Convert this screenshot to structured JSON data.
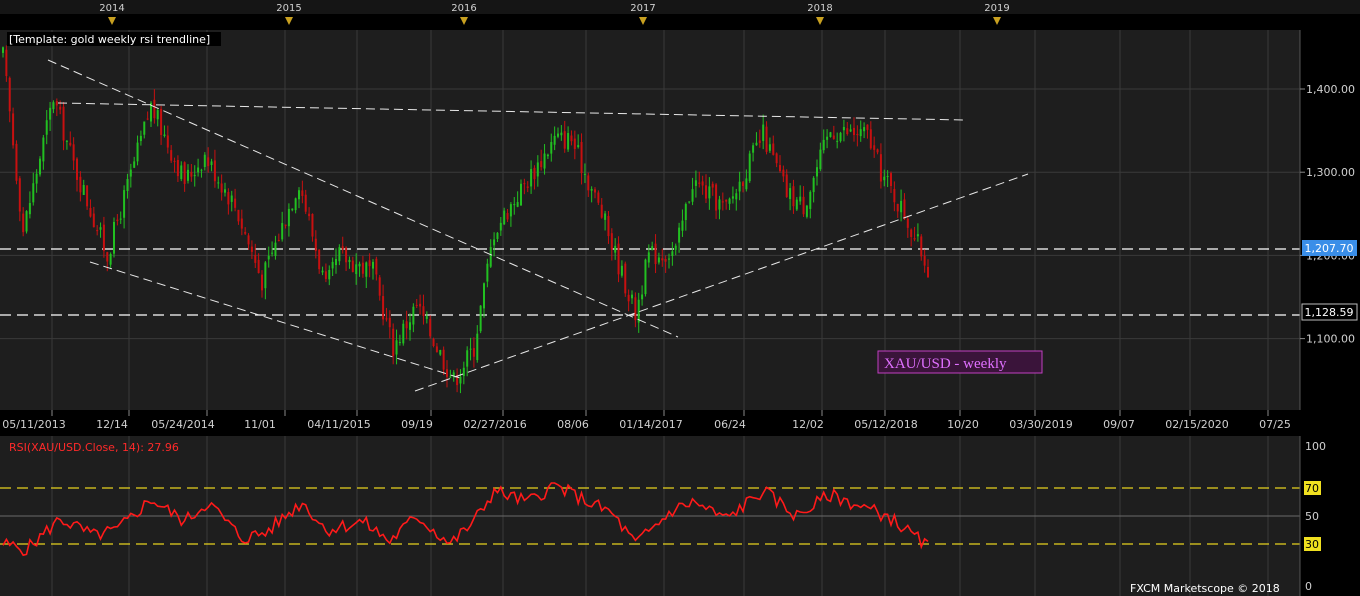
{
  "colors": {
    "background": "#000000",
    "plot_bg": "#1e1e1e",
    "grid": "#3a3a3a",
    "up_candle": "#22c021",
    "down_candle": "#c81010",
    "rsi_line": "#ff1a1a",
    "rsi_level": "#e6d21e",
    "price_tag": "#3a8ee8",
    "annotation_border": "#c040c0",
    "annotation_bg": "#3a143a",
    "annotation_text": "#e070ff",
    "axis_text": "#d0d0d0"
  },
  "top_axis": {
    "years": [
      "2014",
      "2015",
      "2016",
      "2017",
      "2018",
      "2019"
    ],
    "marker_icon": "triangle-marker-icon"
  },
  "price_panel": {
    "template_label": "[Template: gold weekly rsi trendline]",
    "annotation": "XAU/USD - weekly",
    "current_price_tag": "1,207.70",
    "level_tag": "1,128.59"
  },
  "rsi_panel": {
    "label": "RSI(XAU/USD.Close, 14): 27.96",
    "axis_labels": [
      "100",
      "70",
      "50",
      "30",
      "0"
    ],
    "highlighted_levels": [
      "70",
      "30"
    ],
    "levels": [
      30,
      50,
      70
    ],
    "footer": "FXCM Marketscope © 2018"
  },
  "chart_data": [
    {
      "type": "candlestick",
      "title": "XAU/USD - weekly",
      "x_tick_labels": [
        "05/11/2013",
        "12/14",
        "05/24/2014",
        "11/01",
        "04/11/2015",
        "09/19",
        "02/27/2016",
        "08/06",
        "01/14/2017",
        "06/24",
        "12/02",
        "05/12/2018",
        "10/20",
        "03/30/2019",
        "09/07",
        "02/15/2020",
        "07/25"
      ],
      "y_tick_labels": [
        "1,400.00",
        "1,300.00",
        "1,200.00",
        "1,100.00"
      ],
      "ylim": [
        1020,
        1470
      ],
      "approx_close_path": [
        [
          "2013-05-11",
          1440
        ],
        [
          "2013-06-22",
          1230
        ],
        [
          "2013-08-24",
          1390
        ],
        [
          "2013-10-05",
          1310
        ],
        [
          "2013-12-14",
          1200
        ],
        [
          "2014-03-15",
          1380
        ],
        [
          "2014-05-24",
          1290
        ],
        [
          "2014-07-05",
          1320
        ],
        [
          "2014-09-06",
          1260
        ],
        [
          "2014-11-01",
          1170
        ],
        [
          "2015-01-17",
          1290
        ],
        [
          "2015-03-14",
          1160
        ],
        [
          "2015-04-11",
          1200
        ],
        [
          "2015-06-20",
          1180
        ],
        [
          "2015-08-01",
          1090
        ],
        [
          "2015-09-19",
          1140
        ],
        [
          "2015-12-05",
          1050
        ],
        [
          "2016-01-16",
          1090
        ],
        [
          "2016-02-27",
          1230
        ],
        [
          "2016-07-02",
          1340
        ],
        [
          "2016-08-06",
          1340
        ],
        [
          "2016-10-08",
          1250
        ],
        [
          "2016-12-17",
          1130
        ],
        [
          "2017-01-14",
          1200
        ],
        [
          "2017-03-11",
          1205
        ],
        [
          "2017-04-15",
          1290
        ],
        [
          "2017-06-24",
          1255
        ],
        [
          "2017-09-09",
          1345
        ],
        [
          "2017-10-28",
          1275
        ],
        [
          "2017-12-02",
          1260
        ],
        [
          "2018-01-27",
          1350
        ],
        [
          "2018-04-14",
          1345
        ],
        [
          "2018-05-12",
          1300
        ],
        [
          "2018-06-30",
          1250
        ],
        [
          "2018-08-18",
          1185
        ]
      ],
      "horizontal_levels": [
        1207.7,
        1128.59
      ]
    },
    {
      "type": "line",
      "name": "RSI(XAU/USD.Close, 14)",
      "ylim": [
        0,
        100
      ],
      "last_value": 27.96,
      "approx_points": [
        [
          "2013-05-11",
          30
        ],
        [
          "2013-06-29",
          26
        ],
        [
          "2013-09-07",
          48
        ],
        [
          "2013-11-16",
          36
        ],
        [
          "2014-01-04",
          40
        ],
        [
          "2014-03-15",
          62
        ],
        [
          "2014-05-24",
          46
        ],
        [
          "2014-07-12",
          60
        ],
        [
          "2014-09-20",
          34
        ],
        [
          "2014-11-08",
          38
        ],
        [
          "2015-01-24",
          60
        ],
        [
          "2015-03-14",
          40
        ],
        [
          "2015-05-30",
          46
        ],
        [
          "2015-07-25",
          32
        ],
        [
          "2015-09-19",
          50
        ],
        [
          "2015-11-28",
          30
        ],
        [
          "2016-01-16",
          46
        ],
        [
          "2016-02-27",
          68
        ],
        [
          "2016-05-07",
          60
        ],
        [
          "2016-07-02",
          72
        ],
        [
          "2016-09-10",
          60
        ],
        [
          "2016-10-29",
          52
        ],
        [
          "2016-12-17",
          30
        ],
        [
          "2017-03-04",
          54
        ],
        [
          "2017-04-15",
          60
        ],
        [
          "2017-06-24",
          48
        ],
        [
          "2017-09-09",
          68
        ],
        [
          "2017-11-18",
          50
        ],
        [
          "2018-01-27",
          65
        ],
        [
          "2018-04-07",
          56
        ],
        [
          "2018-05-26",
          50
        ],
        [
          "2018-08-18",
          28
        ]
      ]
    }
  ]
}
